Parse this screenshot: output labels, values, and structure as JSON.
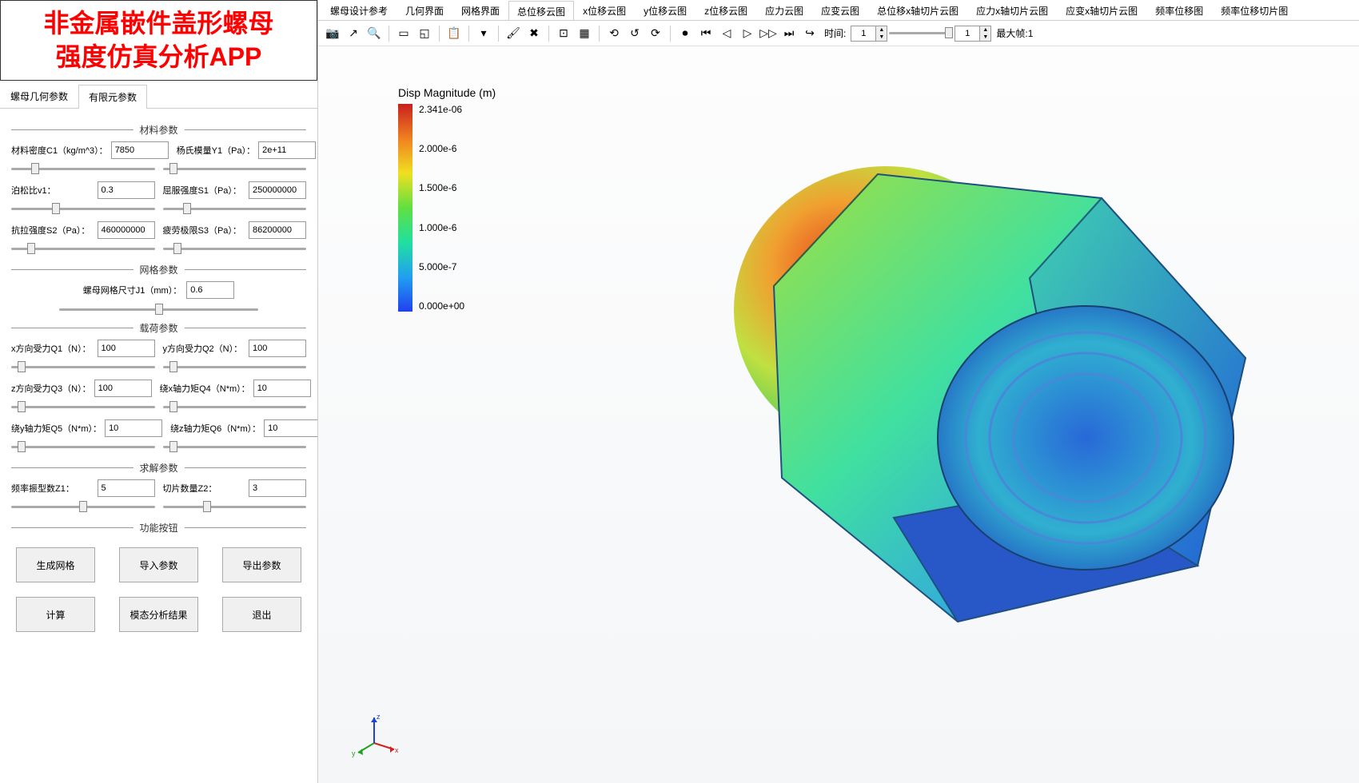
{
  "title": {
    "line1": "非金属嵌件盖形螺母",
    "line2": "强度仿真分析APP"
  },
  "side_tabs": [
    "螺母几何参数",
    "有限元参数"
  ],
  "sections": {
    "material": "材料参数",
    "mesh": "网格参数",
    "load": "载荷参数",
    "solve": "求解参数",
    "buttons": "功能按钮"
  },
  "fields": {
    "c1": {
      "label": "材料密度C1（kg/m^3）：",
      "value": "7850"
    },
    "y1": {
      "label": "杨氏模量Y1（Pa）：",
      "value": "2e+11"
    },
    "v1": {
      "label": "泊松比v1：",
      "value": "0.3"
    },
    "s1": {
      "label": "屈服强度S1（Pa）：",
      "value": "250000000"
    },
    "s2": {
      "label": "抗拉强度S2（Pa）：",
      "value": "460000000"
    },
    "s3": {
      "label": "疲劳极限S3（Pa）：",
      "value": "86200000"
    },
    "j1": {
      "label": "螺母网格尺寸J1（mm）：",
      "value": "0.6"
    },
    "q1": {
      "label": "x方向受力Q1（N）：",
      "value": "100"
    },
    "q2": {
      "label": "y方向受力Q2（N）：",
      "value": "100"
    },
    "q3": {
      "label": "z方向受力Q3（N）：",
      "value": "100"
    },
    "q4": {
      "label": "绕x轴力矩Q4（N*m）：",
      "value": "10"
    },
    "q5": {
      "label": "绕y轴力矩Q5（N*m）：",
      "value": "10"
    },
    "q6": {
      "label": "绕z轴力矩Q6（N*m）：",
      "value": "10"
    },
    "z1": {
      "label": "频率振型数Z1：",
      "value": "5"
    },
    "z2": {
      "label": "切片数量Z2：",
      "value": "3"
    }
  },
  "buttons": {
    "b1": "生成网格",
    "b2": "导入参数",
    "b3": "导出参数",
    "b4": "计算",
    "b5": "模态分析结果",
    "b6": "退出"
  },
  "top_tabs": [
    "螺母设计参考",
    "几何界面",
    "网格界面",
    "总位移云图",
    "x位移云图",
    "y位移云图",
    "z位移云图",
    "应力云图",
    "应变云图",
    "总位移x轴切片云图",
    "应力x轴切片云图",
    "应变x轴切片云图",
    "频率位移图",
    "频率位移切片图"
  ],
  "toolbar": {
    "time": "时间:",
    "time_val": "1",
    "frame_val": "1",
    "maxframe_label": "最大帧:",
    "maxframe_val": "1"
  },
  "legend": {
    "title": "Disp Magnitude (m)",
    "ticks": [
      "2.341e-06",
      "2.000e-6",
      "1.500e-6",
      "1.000e-6",
      "5.000e-7",
      "0.000e+00"
    ]
  }
}
